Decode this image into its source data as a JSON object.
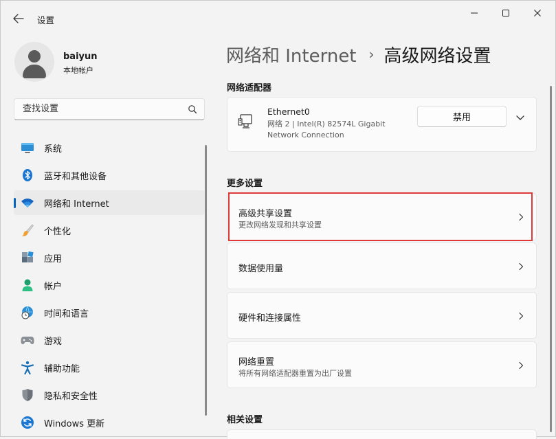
{
  "window": {
    "title": "设置",
    "controls": [
      "minimize",
      "maximize",
      "close"
    ]
  },
  "profile": {
    "name": "baiyun",
    "account_type": "本地帐户"
  },
  "search": {
    "placeholder": "查找设置",
    "value": ""
  },
  "sidebar": {
    "items": [
      {
        "label": "系统",
        "icon": "system-icon",
        "active": false
      },
      {
        "label": "蓝牙和其他设备",
        "icon": "bluetooth-icon",
        "active": false
      },
      {
        "label": "网络和 Internet",
        "icon": "wifi-icon",
        "active": true
      },
      {
        "label": "个性化",
        "icon": "brush-icon",
        "active": false
      },
      {
        "label": "应用",
        "icon": "apps-icon",
        "active": false
      },
      {
        "label": "帐户",
        "icon": "person-icon",
        "active": false
      },
      {
        "label": "时间和语言",
        "icon": "globe-clock-icon",
        "active": false
      },
      {
        "label": "游戏",
        "icon": "gamepad-icon",
        "active": false
      },
      {
        "label": "辅助功能",
        "icon": "accessibility-icon",
        "active": false
      },
      {
        "label": "隐私和安全性",
        "icon": "shield-icon",
        "active": false
      },
      {
        "label": "Windows 更新",
        "icon": "update-icon",
        "active": false
      }
    ]
  },
  "breadcrumb": {
    "parent": "网络和 Internet",
    "separator": "›",
    "current": "高级网络设置"
  },
  "sections": {
    "adapters": "网络适配器",
    "more": "更多设置",
    "related": "相关设置"
  },
  "adapter": {
    "name": "Ethernet0",
    "description": "网络 2 | Intel(R) 82574L Gigabit Network Connection",
    "button": "禁用"
  },
  "more_settings": [
    {
      "title": "高级共享设置",
      "subtitle": "更改网络发现和共享设置",
      "highlighted": true
    },
    {
      "title": "数据使用量",
      "subtitle": ""
    },
    {
      "title": "硬件和连接属性",
      "subtitle": ""
    },
    {
      "title": "网络重置",
      "subtitle": "将所有网络适配器重置为出厂设置"
    }
  ],
  "colors": {
    "accent": "#0067c0",
    "highlight_border": "#e0393a",
    "window_bg": "#f3f3f3",
    "card_bg": "#fbfbfb"
  }
}
